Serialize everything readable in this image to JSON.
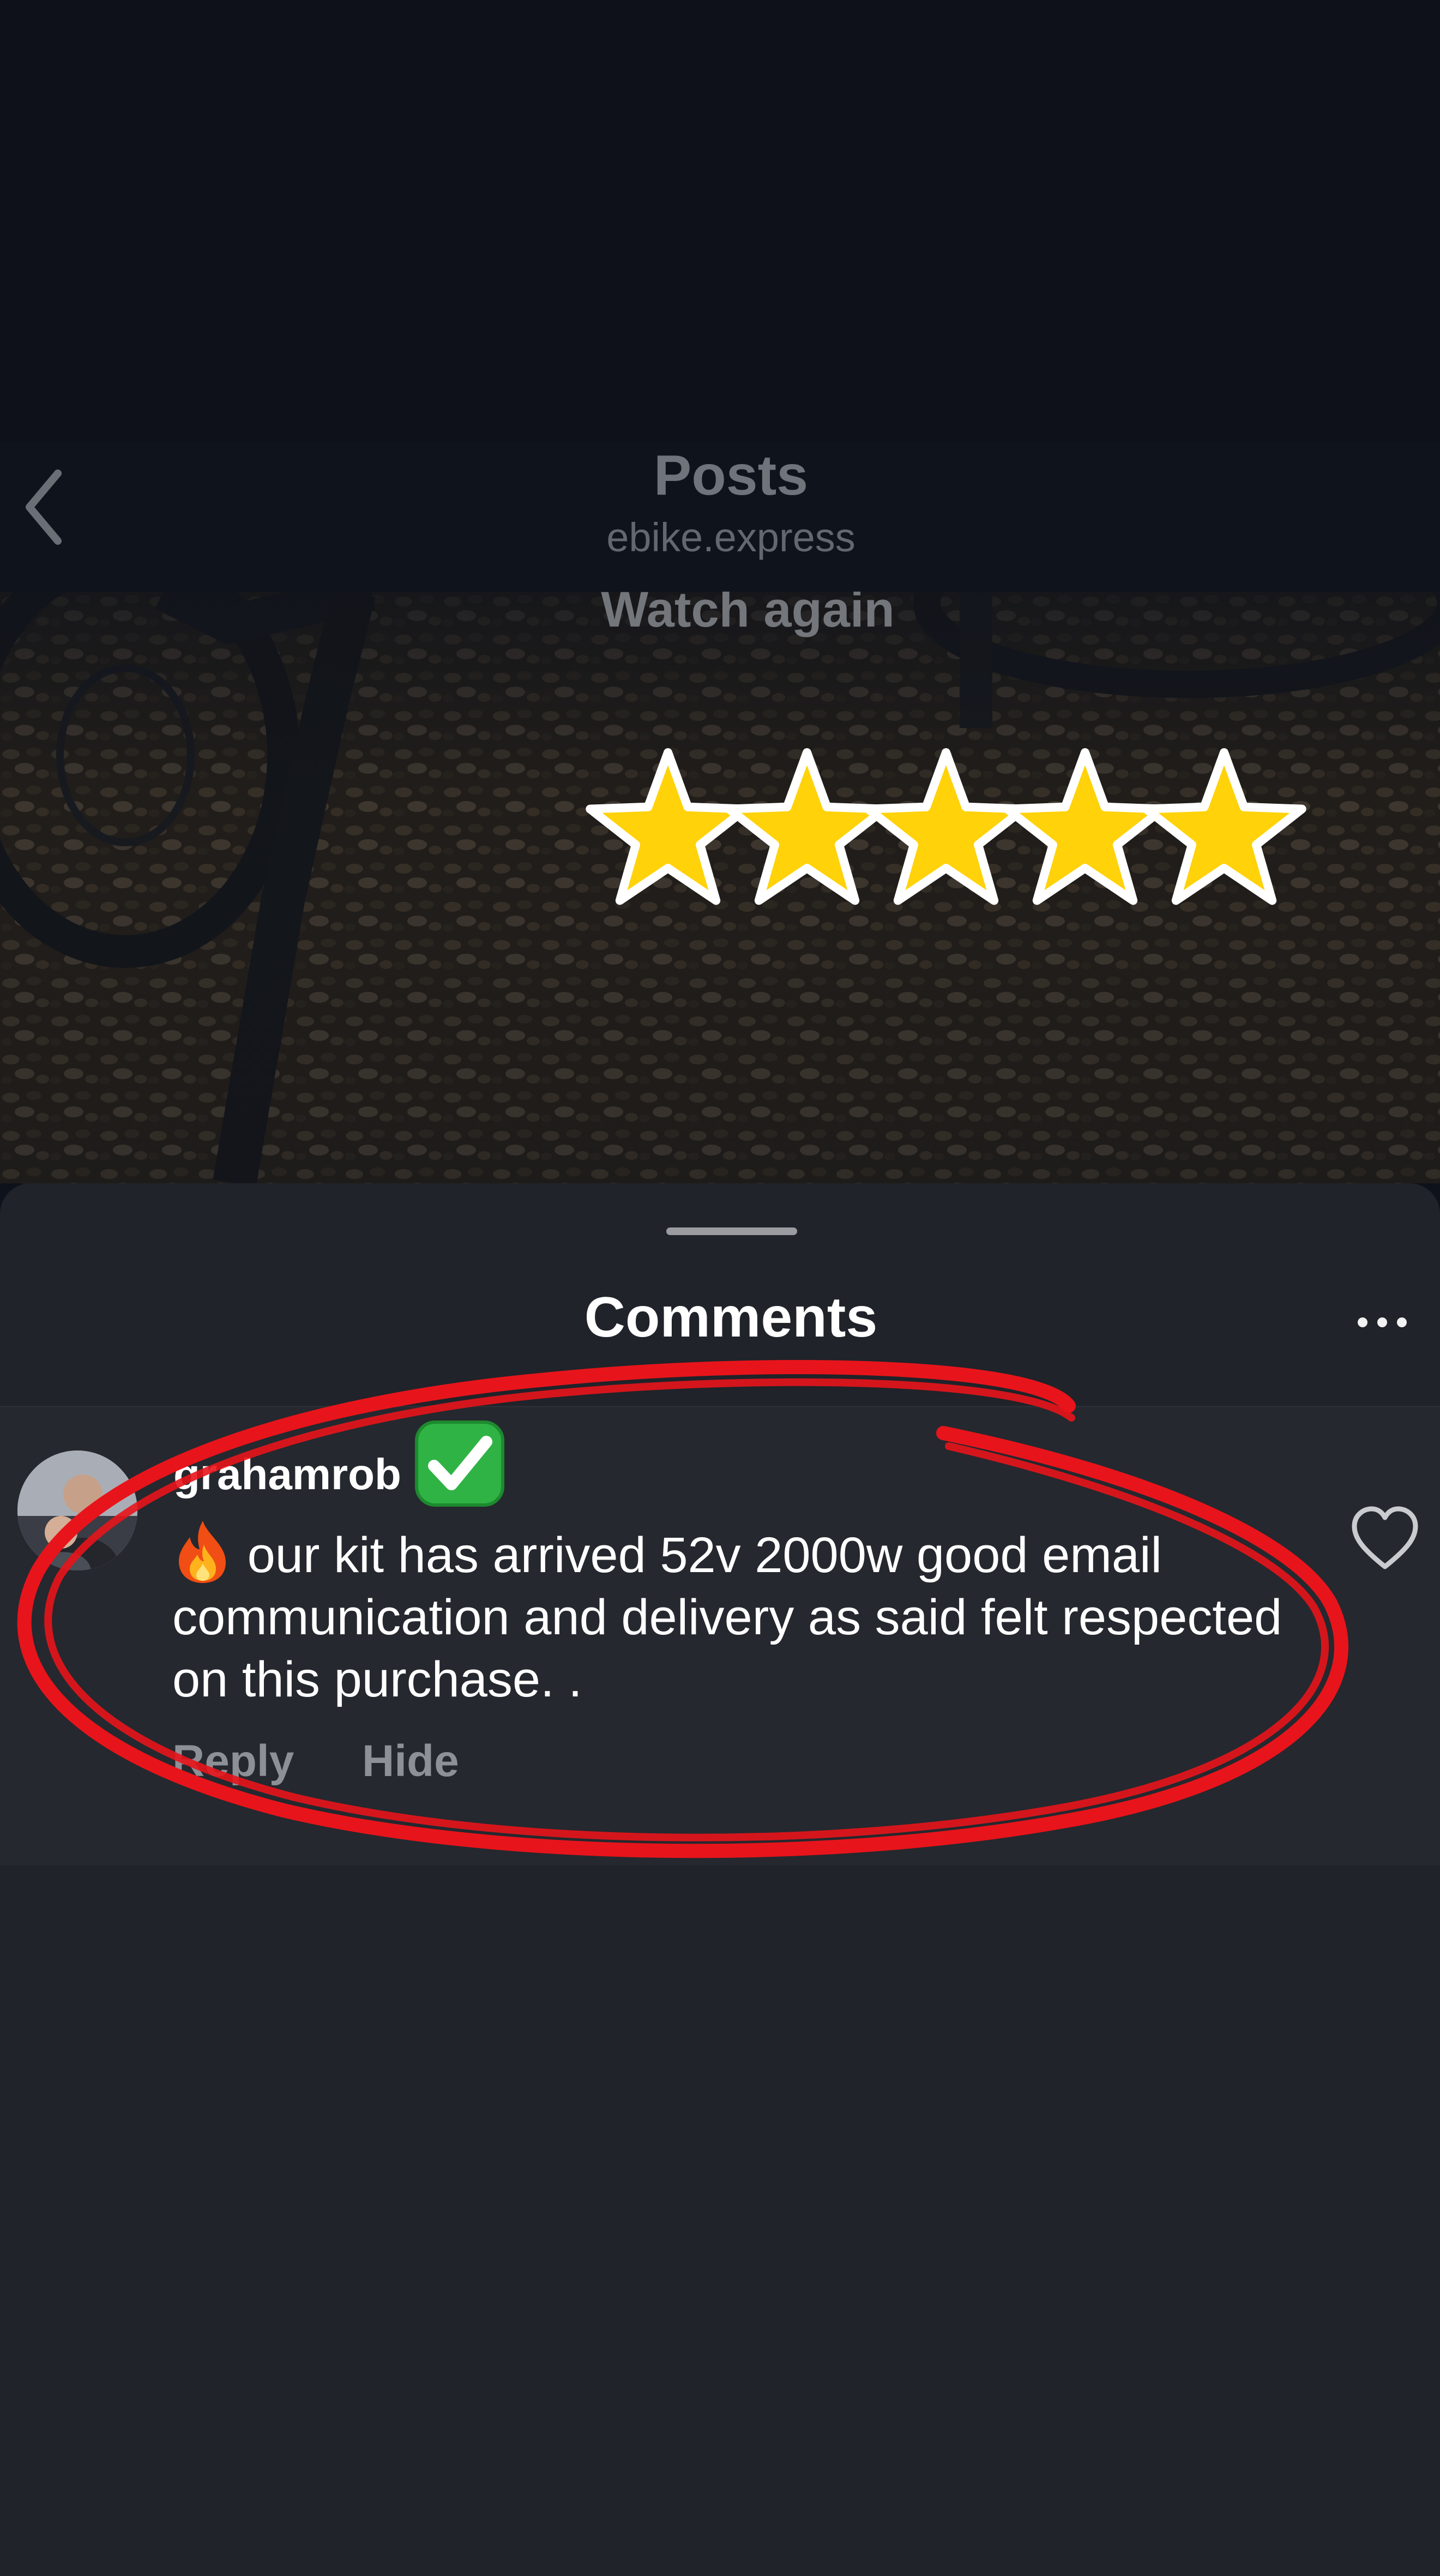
{
  "header": {
    "title": "Posts",
    "subtitle": "ebike.express",
    "back_icon": "chevron-left-icon"
  },
  "video": {
    "overlay_label": "Watch again",
    "rating": {
      "value": 5,
      "max": 5,
      "icon": "star-icon",
      "color": "#ffd20a"
    }
  },
  "comments": {
    "title": "Comments",
    "more_icon": "more-dots-icon",
    "items": [
      {
        "username": "grahamrob",
        "badge_icon": "check-mark-icon",
        "emoji_icon": "fire-icon",
        "text": "our kit has arrived 52v 2000w good email communication and delivery as said felt respected on this purchase. .",
        "actions": {
          "reply": "Reply",
          "hide": "Hide"
        },
        "like_icon": "heart-outline-icon"
      }
    ]
  },
  "colors": {
    "sheet_bg": "#202329",
    "annotation_red": "#e8141b",
    "verified_green": "#2fb344"
  }
}
